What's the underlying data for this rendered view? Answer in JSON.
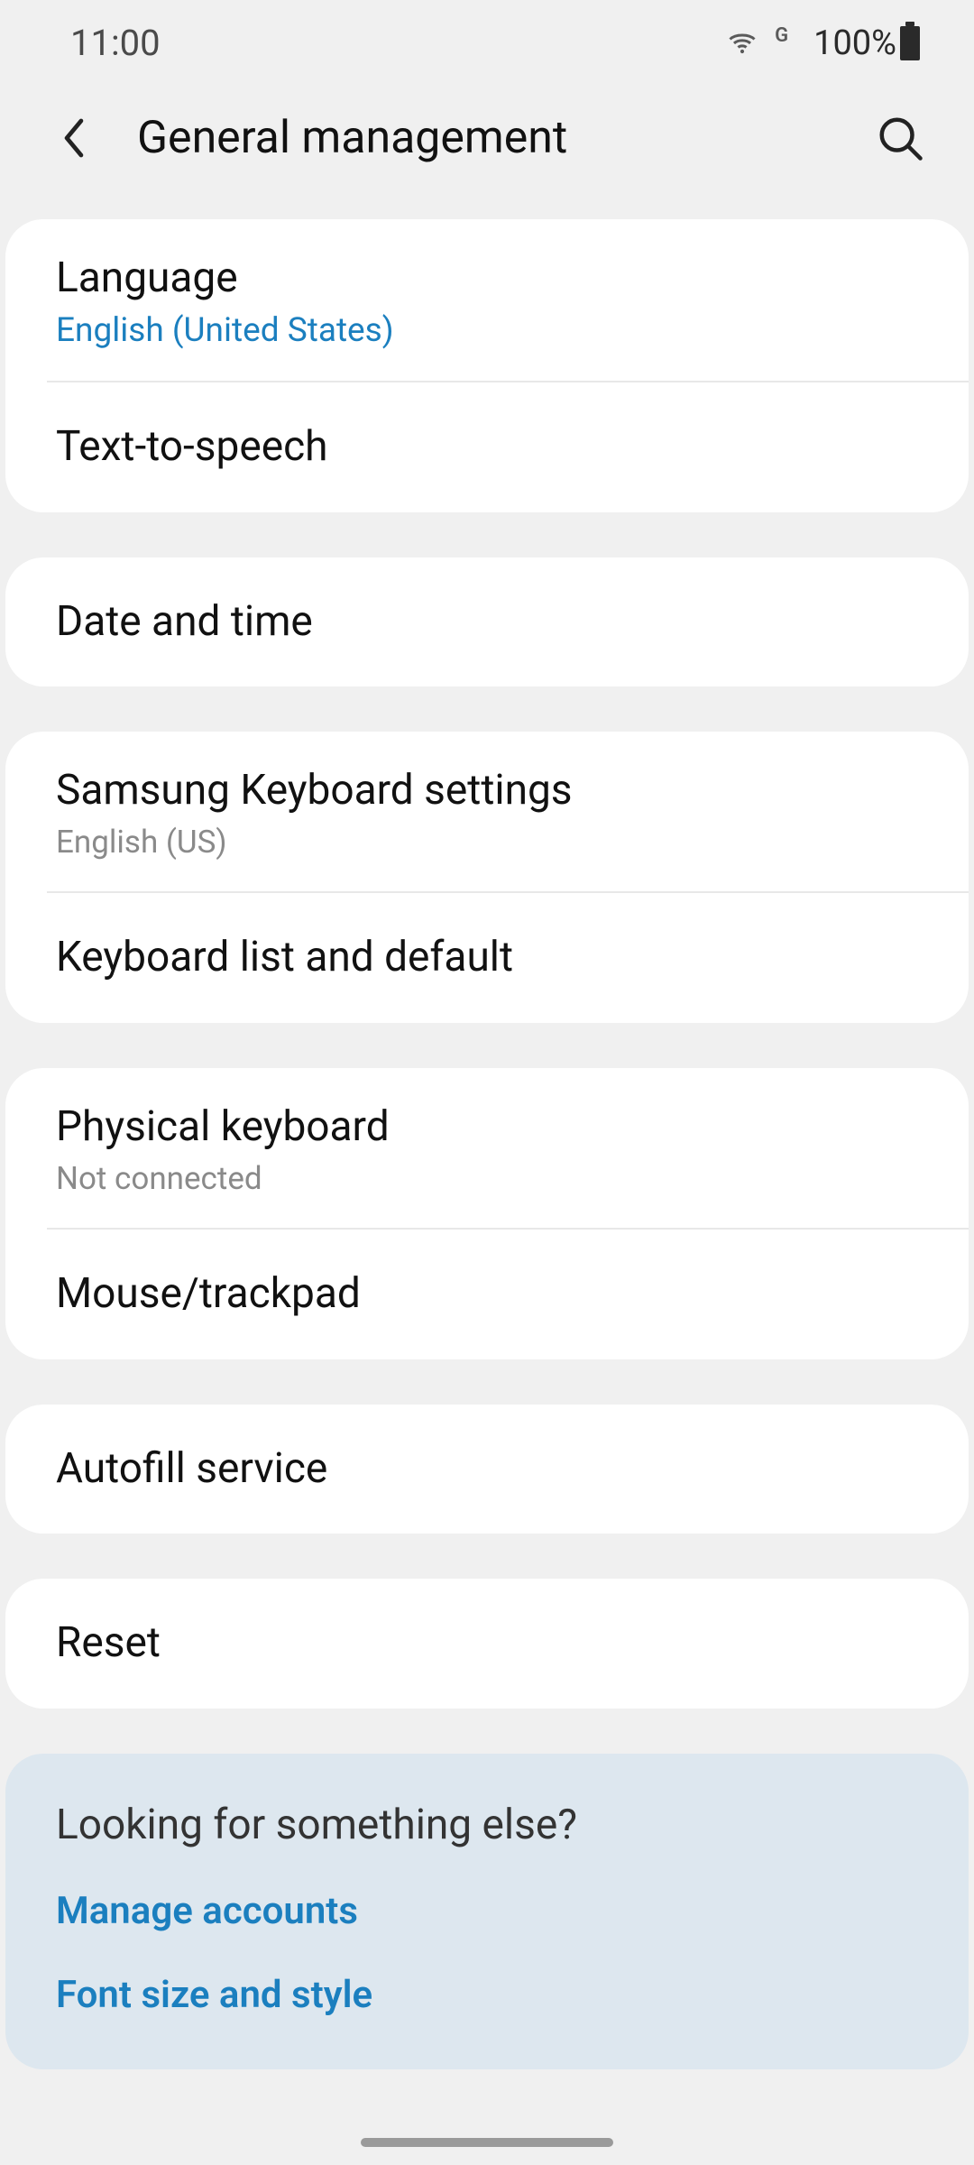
{
  "status": {
    "time": "11:00",
    "network_indicator": "G",
    "battery_text": "100%"
  },
  "header": {
    "title": "General management"
  },
  "groups": [
    {
      "rows": [
        {
          "title": "Language",
          "sub": "English (United States)",
          "sub_accent": true
        },
        {
          "title": "Text-to-speech"
        }
      ]
    },
    {
      "rows": [
        {
          "title": "Date and time"
        }
      ]
    },
    {
      "rows": [
        {
          "title": "Samsung Keyboard settings",
          "sub": "English (US)"
        },
        {
          "title": "Keyboard list and default"
        }
      ]
    },
    {
      "rows": [
        {
          "title": "Physical keyboard",
          "sub": "Not connected"
        },
        {
          "title": "Mouse/trackpad"
        }
      ]
    },
    {
      "rows": [
        {
          "title": "Autofill service"
        }
      ]
    },
    {
      "rows": [
        {
          "title": "Reset"
        }
      ]
    }
  ],
  "suggestions": {
    "heading": "Looking for something else?",
    "links": [
      "Manage accounts",
      "Font size and style"
    ]
  }
}
